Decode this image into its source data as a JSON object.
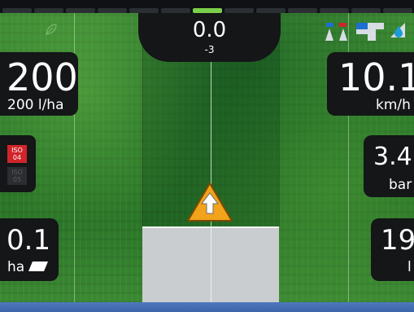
{
  "top_indicator": {
    "active_index": 6
  },
  "heading": {
    "value": "0.0",
    "sub": "-3"
  },
  "left": {
    "rate": {
      "value": "200",
      "unit": "200 l/ha"
    },
    "iso_primary": {
      "line1": "ISO",
      "line2": "04"
    },
    "iso_secondary": {
      "line1": "ISO",
      "line2": "05"
    },
    "area": {
      "value": "0.1",
      "unit": "ha"
    }
  },
  "right": {
    "speed": {
      "value": "10.1",
      "unit": "km/h"
    },
    "pressure": {
      "value": "3.4",
      "unit": "bar"
    },
    "volume": {
      "value": "19",
      "unit": "l"
    }
  },
  "icons": [
    "leaf-icon",
    "sprayer-nozzles-icon",
    "sprayer-boom-icon",
    "droplet-icon",
    "direction-arrow-icon",
    "area-icon"
  ],
  "colors": {
    "accent": "#7bd04a",
    "iso_active": "#d0252a",
    "arrow": "#f2a31b",
    "footer": "#4e78bd"
  }
}
